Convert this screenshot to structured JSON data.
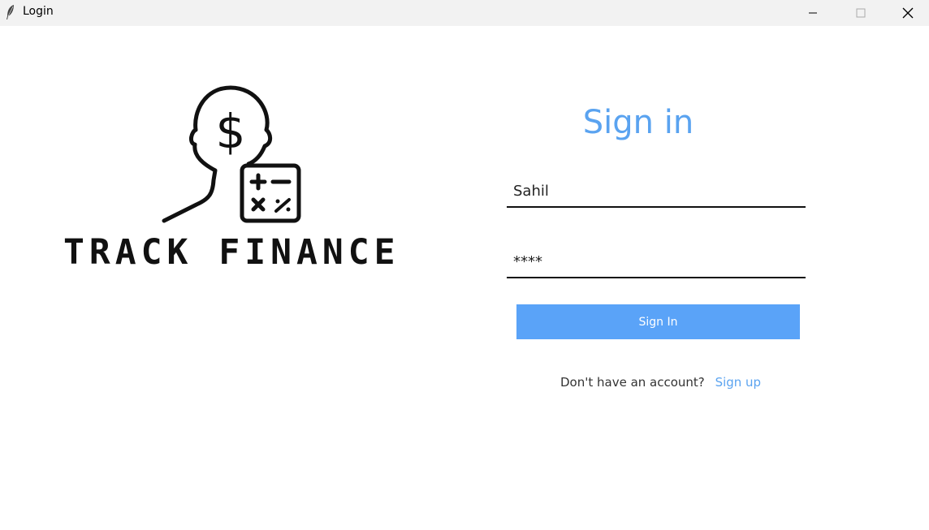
{
  "window": {
    "title": "Login",
    "icons": {
      "app": "feather-icon",
      "minimize": "minimize-icon",
      "maximize": "maximize-icon",
      "close": "close-icon"
    }
  },
  "logo": {
    "text": "TRACK FINANCE",
    "icon": "head-dollar-calculator-icon",
    "dollar": "$"
  },
  "form": {
    "title": "Sign in",
    "username_value": "Sahil",
    "password_value": "****",
    "submit_label": "Sign In",
    "signup_prompt": "Don't have an account?",
    "signup_link": "Sign up"
  },
  "colors": {
    "accent": "#5aa3f0",
    "button": "#5aa3f8",
    "titlebar": "#f2f2f2"
  }
}
